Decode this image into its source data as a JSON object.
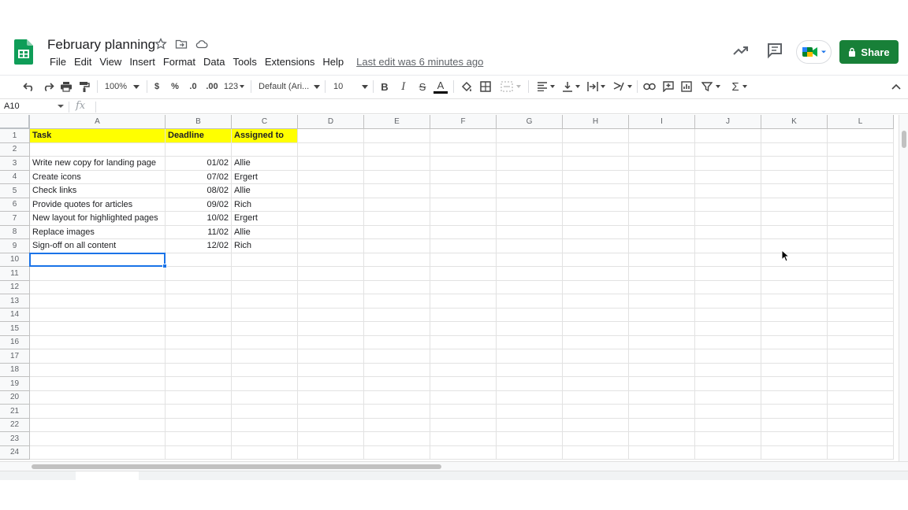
{
  "header": {
    "title": "February planning",
    "menu": [
      "File",
      "Edit",
      "View",
      "Insert",
      "Format",
      "Data",
      "Tools",
      "Extensions",
      "Help"
    ],
    "last_edit": "Last edit was 6 minutes ago",
    "share_label": "Share"
  },
  "toolbar": {
    "zoom": "100%",
    "currency": "$",
    "percent": "%",
    "decimal_decrease": ".0",
    "decimal_increase": ".00",
    "more_formats": "123",
    "font": "Default (Ari...",
    "font_size": "10",
    "bold": "B",
    "italic": "I",
    "strikethrough": "S",
    "text_color_letter": "A",
    "sum": "Σ"
  },
  "formula_bar": {
    "cell_ref": "A10",
    "fx": "fx",
    "value": ""
  },
  "columns": [
    "A",
    "B",
    "C",
    "D",
    "E",
    "F",
    "G",
    "H",
    "I",
    "J",
    "K",
    "L"
  ],
  "rows": [
    "1",
    "2",
    "3",
    "4",
    "5",
    "6",
    "7",
    "8",
    "9",
    "10",
    "11",
    "12",
    "13",
    "14",
    "15",
    "16",
    "17",
    "18",
    "19",
    "20",
    "21",
    "22",
    "23",
    "24"
  ],
  "sheet": {
    "headers": [
      "Task",
      "Deadline",
      "Assigned to"
    ],
    "tasks": [
      [
        "Write new copy for landing page",
        "01/02",
        "Allie"
      ],
      [
        "Create icons",
        "07/02",
        "Ergert"
      ],
      [
        "Check links",
        "08/02",
        "Allie"
      ],
      [
        "Provide quotes for articles",
        "09/02",
        "Rich"
      ],
      [
        "New layout for highlighted pages",
        "10/02",
        "Ergert"
      ],
      [
        "Replace images",
        "11/02",
        "Allie"
      ],
      [
        "Sign-off on all content",
        "12/02",
        "Rich"
      ]
    ],
    "selected_cell": "A10"
  },
  "colors": {
    "header_fill": "#ffff00",
    "share_green": "#188038",
    "selection_blue": "#1a73e8",
    "sheets_green": "#0f9d58"
  },
  "icons": [
    "sheets-logo-icon",
    "star-icon",
    "move-folder-icon",
    "cloud-status-icon",
    "trend-icon",
    "comment-icon",
    "meet-icon",
    "lock-icon",
    "undo-icon",
    "redo-icon",
    "print-icon",
    "paint-format-icon",
    "fill-color-icon",
    "borders-icon",
    "merge-icon",
    "align-icon",
    "valign-icon",
    "wrap-icon",
    "rotate-icon",
    "link-icon",
    "insert-comment-icon",
    "chart-icon",
    "filter-icon",
    "collapse-icon",
    "mouse-cursor-icon"
  ]
}
